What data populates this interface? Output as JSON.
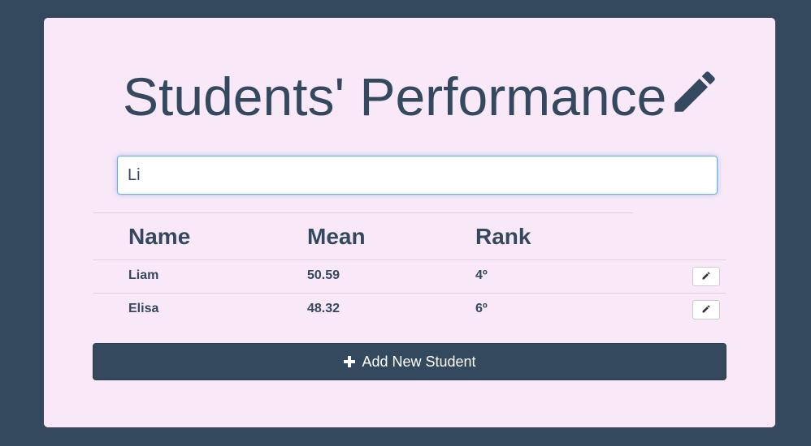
{
  "header": {
    "title": "Students' Performance",
    "title_icon": "pencil-icon"
  },
  "search": {
    "value": "Li",
    "placeholder": ""
  },
  "table": {
    "columns": [
      "Name",
      "Mean",
      "Rank"
    ],
    "rows": [
      {
        "name": "Liam",
        "mean": "50.59",
        "rank": "4º",
        "action_icon": "pencil-icon"
      },
      {
        "name": "Elisa",
        "mean": "48.32",
        "rank": "6º",
        "action_icon": "pencil-icon"
      }
    ]
  },
  "actions": {
    "add_label": "Add New Student",
    "add_icon": "plus-icon"
  },
  "colors": {
    "page_background": "#34495e",
    "card_background": "#f8e8f8",
    "primary": "#34495e",
    "focus_border": "#66afe9"
  }
}
